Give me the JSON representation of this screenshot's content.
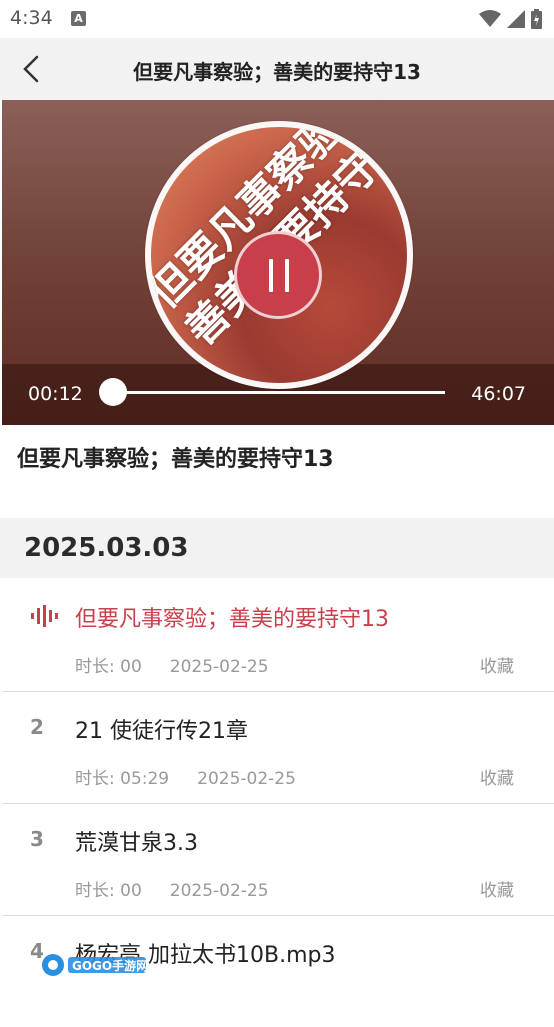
{
  "status": {
    "time": "4:34",
    "notification_letter": "A"
  },
  "nav": {
    "title": "但要凡事察验；善美的要持守13"
  },
  "player": {
    "cover_text_line1": "但要凡事察验",
    "cover_text_line2": "善美的要持守",
    "time_current": "00:12",
    "time_total": "46:07",
    "progress": 0.004
  },
  "track": {
    "title": "但要凡事察验；善美的要持守13"
  },
  "playlist": {
    "date": "2025.03.03",
    "items": [
      {
        "index": "",
        "title": "但要凡事察验；善美的要持守13",
        "duration": "时长: 00",
        "date": "2025-02-25",
        "fav": "收藏",
        "playing": true
      },
      {
        "index": "2",
        "title": "21 使徒行传21章",
        "duration": "时长: 05:29",
        "date": "2025-02-25",
        "fav": "收藏",
        "playing": false
      },
      {
        "index": "3",
        "title": "荒漠甘泉3.3",
        "duration": "时长: 00",
        "date": "2025-02-25",
        "fav": "收藏",
        "playing": false
      },
      {
        "index": "4",
        "title": "杨宏亮 加拉太书10B.mp3",
        "duration": "",
        "date": "",
        "fav": "",
        "playing": false
      }
    ]
  },
  "watermark": {
    "text": "GOGO手游网"
  },
  "colors": {
    "accent": "#c8404b",
    "header_bg": "#f2f2f2"
  }
}
